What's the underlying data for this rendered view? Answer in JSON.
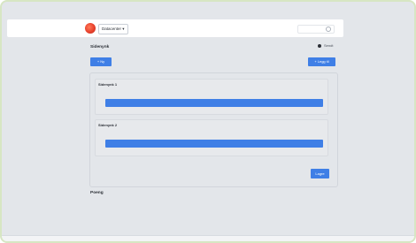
{
  "header": {
    "workspace_label": "Datacenter ▾",
    "brand": "app-logo"
  },
  "page": {
    "title": "Sidenynk",
    "toggle_label": "Sendt"
  },
  "toolbar": {
    "new_label": "+ Ny",
    "add_label": "+ Legg til"
  },
  "form": {
    "cards": [
      {
        "title": "Sidenynk 1",
        "progress": 1
      },
      {
        "title": "Sidenynk 2",
        "progress": 1
      }
    ],
    "save_label": "Lagre"
  },
  "section": {
    "title": "Poeng"
  },
  "colors": {
    "accent": "#3f7fe6",
    "background": "#e3e6ea",
    "topbar": "#ffffff"
  }
}
